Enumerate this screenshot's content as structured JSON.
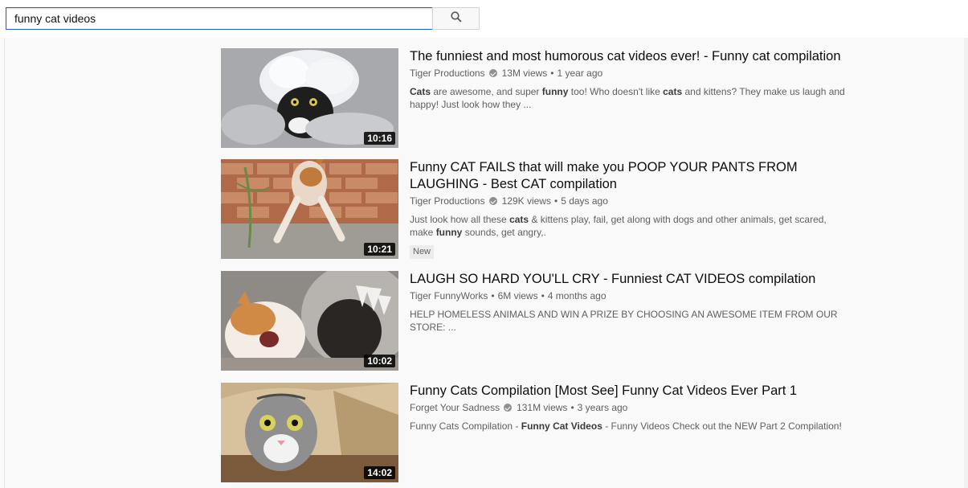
{
  "search": {
    "value": "funny cat videos",
    "button_icon": "search-icon"
  },
  "results": [
    {
      "title": "The funniest and most humorous cat videos ever! - Funny cat compilation",
      "channel": "Tiger Productions",
      "verified": true,
      "views": "13M views",
      "age": "1 year ago",
      "description": [
        {
          "t": "Cats",
          "b": true
        },
        {
          "t": " are awesome, and super ",
          "b": false
        },
        {
          "t": "funny",
          "b": true
        },
        {
          "t": " too! Who doesn't like ",
          "b": false
        },
        {
          "t": "cats",
          "b": true
        },
        {
          "t": " and kittens? They make us laugh and happy! Just look how they ...",
          "b": false
        }
      ],
      "duration": "10:16",
      "badge": ""
    },
    {
      "title": "Funny CAT FAILS that will make you POOP YOUR PANTS FROM LAUGHING - Best CAT compilation",
      "channel": "Tiger Productions",
      "verified": true,
      "views": "129K views",
      "age": "5 days ago",
      "description": [
        {
          "t": "Just look how all these ",
          "b": false
        },
        {
          "t": "cats",
          "b": true
        },
        {
          "t": " & kittens play, fail, get along with dogs and other animals, get scared, make ",
          "b": false
        },
        {
          "t": "funny",
          "b": true
        },
        {
          "t": " sounds, get angry,.",
          "b": false
        }
      ],
      "duration": "10:21",
      "badge": "New"
    },
    {
      "title": "LAUGH SO HARD YOU'LL CRY - Funniest CAT VIDEOS compilation",
      "channel": "Tiger FunnyWorks",
      "verified": false,
      "views": "6M views",
      "age": "4 months ago",
      "description": [
        {
          "t": "HELP HOMELESS ANIMALS AND WIN A PRIZE BY CHOOSING AN AWESOME ITEM FROM OUR STORE: ...",
          "b": false
        }
      ],
      "duration": "10:02",
      "badge": ""
    },
    {
      "title": "Funny Cats Compilation [Most See] Funny Cat Videos Ever Part 1",
      "channel": "Forget Your Sadness",
      "verified": true,
      "views": "131M views",
      "age": "3 years ago",
      "description": [
        {
          "t": "Funny Cats Compilation - ",
          "b": false
        },
        {
          "t": "Funny Cat Videos",
          "b": true
        },
        {
          "t": " - Funny Videos Check out the NEW Part 2 Compilation!",
          "b": false
        }
      ],
      "duration": "14:02",
      "badge": ""
    }
  ]
}
